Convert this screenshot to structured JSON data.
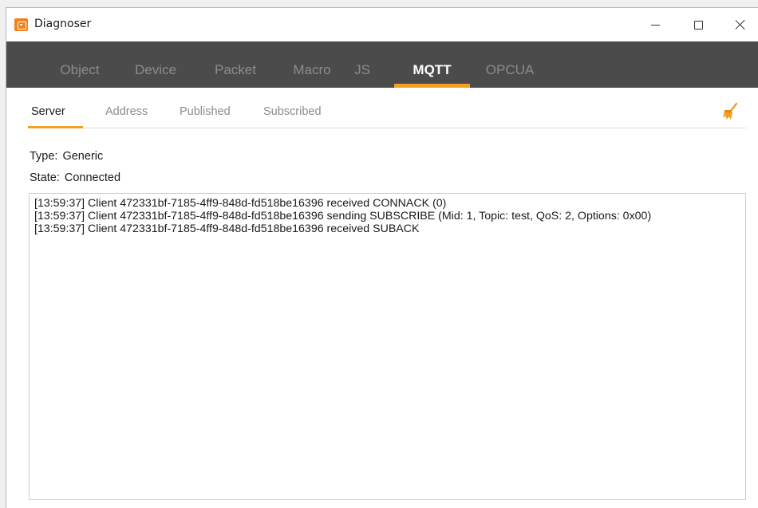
{
  "window": {
    "title": "Diagnoser",
    "controls": {
      "minimize": "minimize",
      "maximize": "maximize",
      "close": "close"
    }
  },
  "main_tabs": [
    {
      "label": "Object",
      "active": false
    },
    {
      "label": "Device",
      "active": false
    },
    {
      "label": "Packet",
      "active": false
    },
    {
      "label": "Macro",
      "active": false
    },
    {
      "label": "JS",
      "active": false
    },
    {
      "label": "MQTT",
      "active": true
    },
    {
      "label": "OPCUA",
      "active": false
    }
  ],
  "sub_tabs": [
    {
      "label": "Server",
      "active": true
    },
    {
      "label": "Address",
      "active": false
    },
    {
      "label": "Published",
      "active": false
    },
    {
      "label": "Subscribed",
      "active": false
    }
  ],
  "info": {
    "type_label": "Type:",
    "type_value": "Generic",
    "state_label": "State:",
    "state_value": "Connected"
  },
  "log": [
    "[13:59:37] Client 472331bf-7185-4ff9-848d-fd518be16396 received CONNACK (0)",
    "[13:59:37] Client 472331bf-7185-4ff9-848d-fd518be16396 sending SUBSCRIBE (Mid: 1, Topic: test, QoS: 2, Options: 0x00)",
    "[13:59:37] Client 472331bf-7185-4ff9-848d-fd518be16396 received SUBACK"
  ],
  "icons": {
    "app": "app-icon",
    "clear": "broom-icon"
  },
  "colors": {
    "accent": "#f39f1f",
    "tab_bar": "#4b4b4b",
    "app_icon": "#f0821e"
  }
}
